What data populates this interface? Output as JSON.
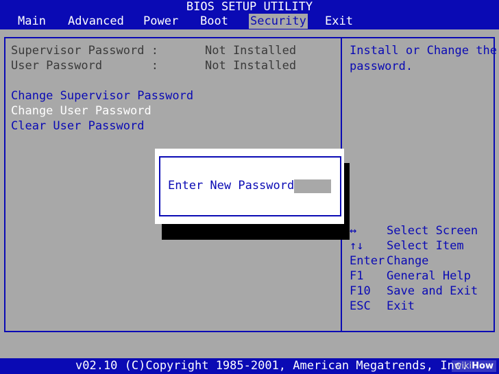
{
  "title": "BIOS SETUP UTILITY",
  "menu": [
    {
      "label": "Main"
    },
    {
      "label": "Advanced"
    },
    {
      "label": "Power"
    },
    {
      "label": "Boot"
    },
    {
      "label": "Security",
      "active": true
    },
    {
      "label": "Exit"
    }
  ],
  "status": {
    "supervisor": {
      "label": "Supervisor Password :",
      "value": "Not Installed"
    },
    "user": {
      "label": "User Password       :",
      "value": "Not Installed"
    }
  },
  "options": {
    "change_supervisor": "Change Supervisor Password",
    "change_user": "Change User Password",
    "clear_user": "Clear User Password"
  },
  "help_text": {
    "line1": "Install or Change the",
    "line2": "password."
  },
  "dialog": {
    "label": "Enter New Password",
    "value": ""
  },
  "keys": [
    {
      "key": "↔",
      "action": "Select Screen"
    },
    {
      "key": "↑↓",
      "action": "Select Item"
    },
    {
      "key": "Enter",
      "action": "Change"
    },
    {
      "key": "F1",
      "action": "General Help"
    },
    {
      "key": "F10",
      "action": "Save and Exit"
    },
    {
      "key": "ESC",
      "action": "Exit"
    }
  ],
  "footer": {
    "copyright": "v02.10 (C)Copyright 1985-2001, American Megatrends, Inc.",
    "watermark_prefix": "wiki",
    "watermark_brand": "How"
  },
  "colors": {
    "blue": "#0a0ab4",
    "gray": "#a8a8a8"
  }
}
